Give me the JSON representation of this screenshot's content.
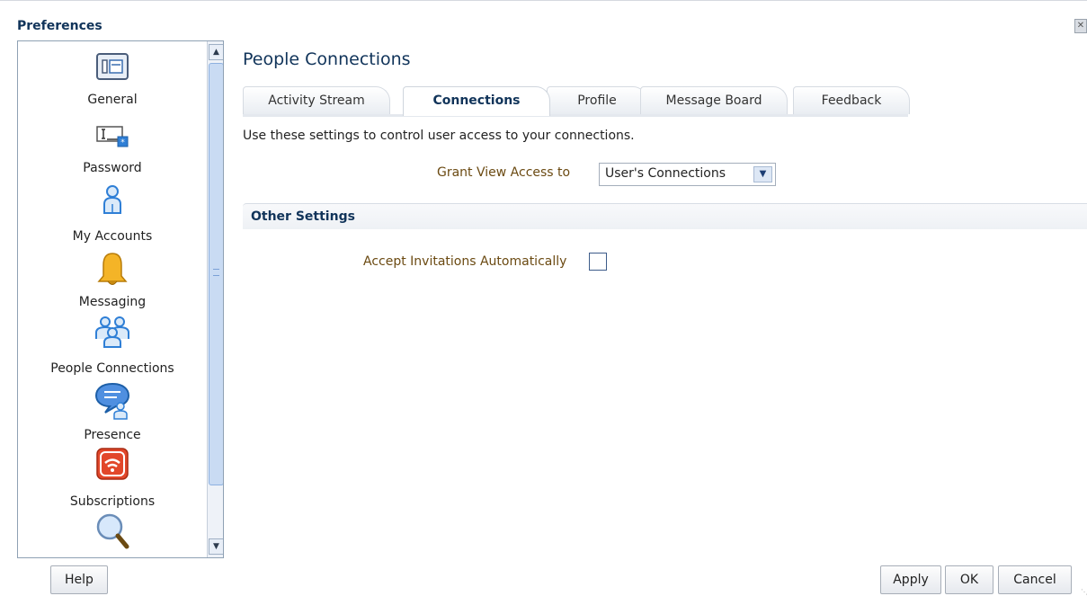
{
  "window": {
    "title": "Preferences",
    "close_glyph": "✕"
  },
  "sidebar": {
    "items": [
      {
        "label": "General",
        "icon": "general-settings-icon"
      },
      {
        "label": "Password",
        "icon": "password-field-icon"
      },
      {
        "label": "My Accounts",
        "icon": "user-icon"
      },
      {
        "label": "Messaging",
        "icon": "bell-icon"
      },
      {
        "label": "People Connections",
        "icon": "people-group-icon"
      },
      {
        "label": "Presence",
        "icon": "presence-chat-icon"
      },
      {
        "label": "Subscriptions",
        "icon": "rss-feed-icon"
      },
      {
        "label": "",
        "icon": "search-magnifier-icon"
      }
    ],
    "scroll_up_glyph": "▲",
    "scroll_down_glyph": "▼"
  },
  "main": {
    "title": "People Connections",
    "tabs": [
      {
        "label": "Activity Stream",
        "active": false
      },
      {
        "label": "Connections",
        "active": true
      },
      {
        "label": "Profile",
        "active": false
      },
      {
        "label": "Message Board",
        "active": false
      },
      {
        "label": "Feedback",
        "active": false
      }
    ],
    "description": "Use these settings to control user access to your connections.",
    "grant_access": {
      "label": "Grant View Access to",
      "value": "User's Connections",
      "dropdown_glyph": "▼"
    },
    "other_settings": {
      "title": "Other Settings"
    },
    "accept_invitations": {
      "label": "Accept Invitations Automatically",
      "checked": false
    }
  },
  "footer": {
    "help_label": "Help",
    "apply_label": "Apply",
    "ok_label": "OK",
    "cancel_label": "Cancel"
  },
  "colors": {
    "title_text": "#11345a",
    "form_label": "#6b4a12",
    "sidebar_border": "#8fa1b4",
    "scroll_thumb": "#c9dbf3",
    "messaging_icon": "#e8a317",
    "subscriptions_icon": "#e2472a"
  }
}
